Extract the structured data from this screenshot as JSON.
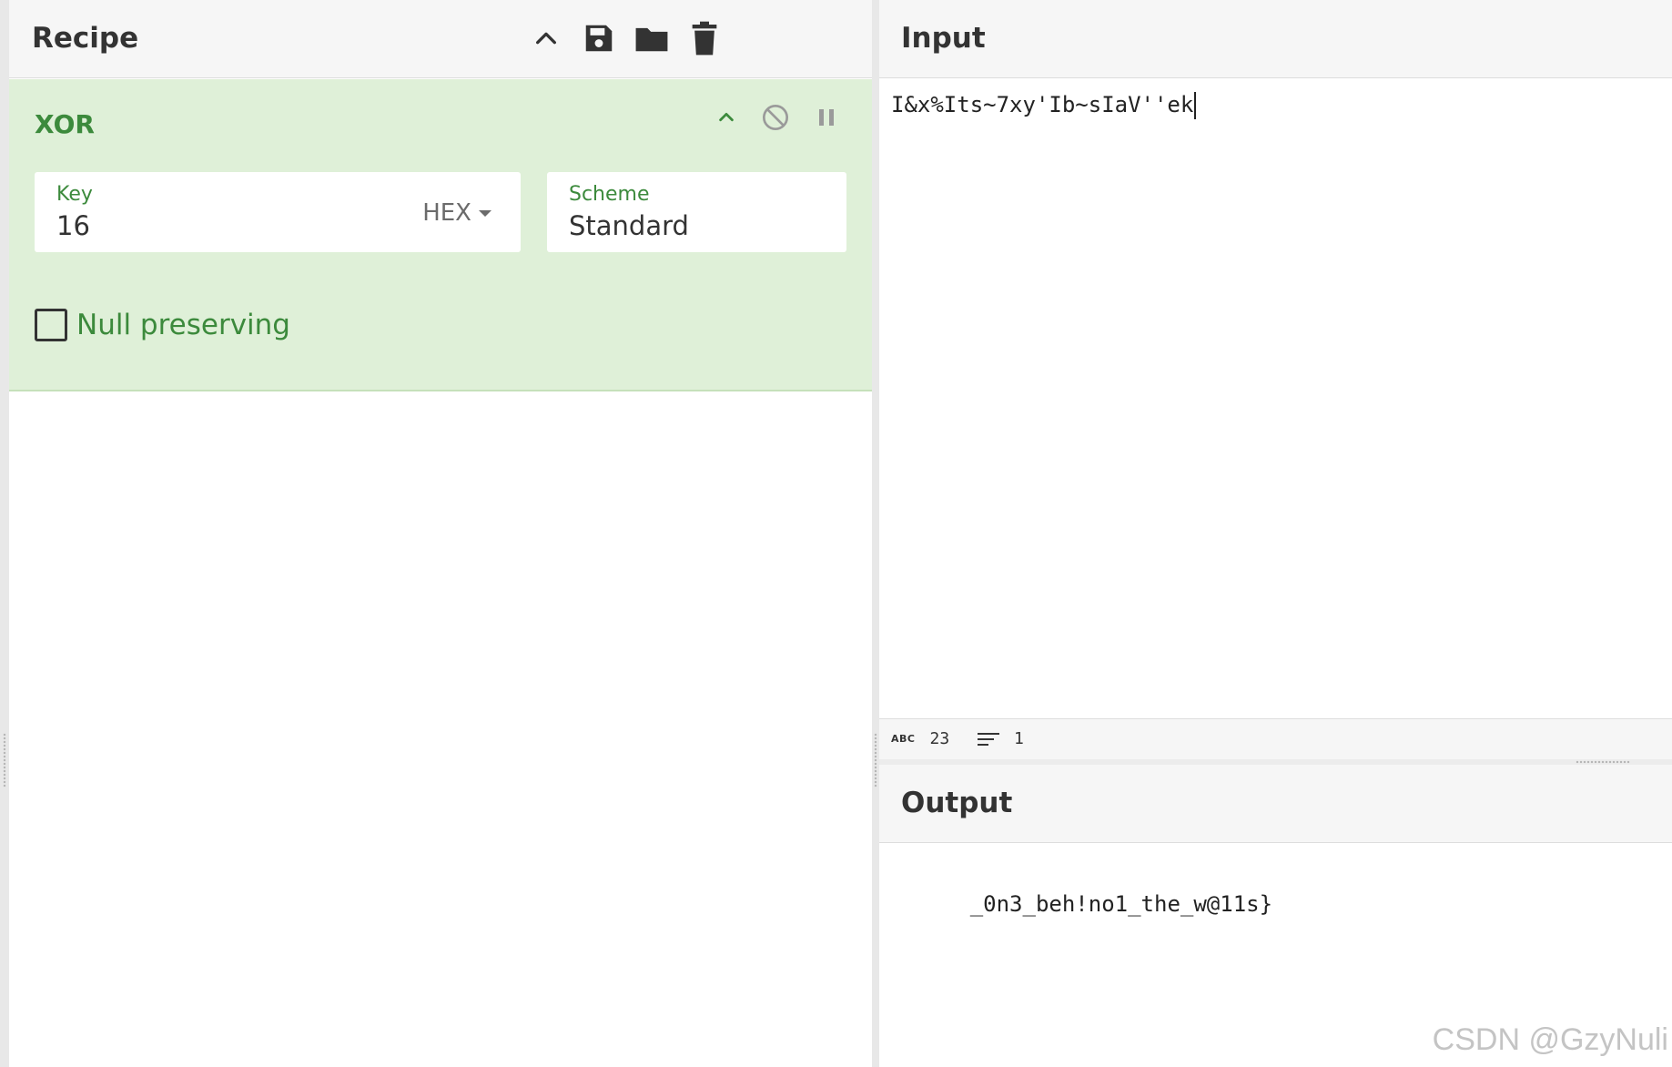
{
  "recipe": {
    "title": "Recipe",
    "toolbar_icons": [
      "chevron-up-icon",
      "save-icon",
      "folder-icon",
      "trash-icon"
    ],
    "operation": {
      "name": "XOR",
      "controls": [
        "chevron-up-icon",
        "disable-icon",
        "pause-icon"
      ],
      "key": {
        "label": "Key",
        "value": "16",
        "format": "HEX"
      },
      "scheme": {
        "label": "Scheme",
        "value": "Standard"
      },
      "null_preserving": {
        "label": "Null preserving",
        "checked": false
      }
    }
  },
  "input": {
    "title": "Input",
    "text": "I&x%Its~7xy'Ib~sIaV''ek",
    "stats": {
      "length": "23",
      "lines": "1"
    }
  },
  "output": {
    "title": "Output",
    "text": "_0n3_beh!no1_the_w@11s}"
  },
  "watermark": "CSDN @GzyNuli",
  "colors": {
    "accent_green": "#3c8a3c",
    "card_background": "#dff0d8",
    "header_background": "#f6f6f6"
  }
}
